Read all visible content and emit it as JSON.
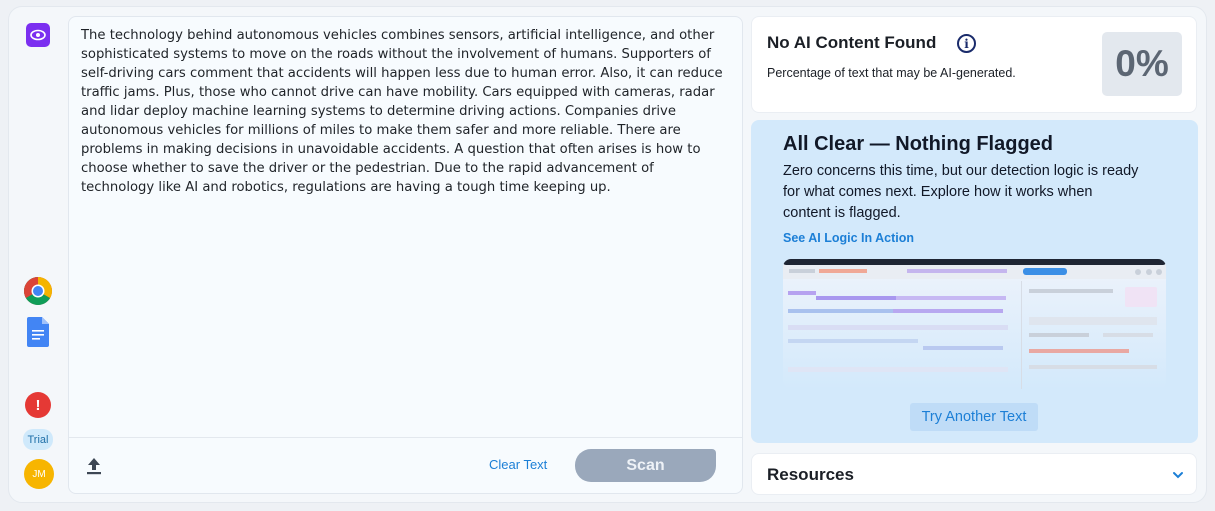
{
  "sidebar": {
    "eye_icon": "eye-icon",
    "chrome_icon": "chrome-icon",
    "docs_icon": "google-docs-icon",
    "alert": "!",
    "trial": "Trial",
    "avatar": "JM"
  },
  "editor": {
    "text": "The technology behind autonomous vehicles combines sensors, artificial intelligence, and other sophisticated systems to move on the roads without the involvement of humans. Supporters of self-driving cars comment that accidents will happen less due to human error. Also, it can reduce traffic jams. Plus, those who cannot drive can have mobility. Cars equipped with cameras, radar and lidar deploy machine learning systems to determine driving actions. Companies drive autonomous vehicles for millions of miles to make them safer and more reliable. There are problems in making decisions in unavoidable accidents. A question that often arises is how to choose whether to save the driver or the pedestrian. Due to the rapid advancement of technology like AI and robotics, regulations are having a tough time keeping up.",
    "clear_label": "Clear Text",
    "scan_label": "Scan"
  },
  "result": {
    "title": "No AI Content Found",
    "subtitle": "Percentage of text that may be AI-generated.",
    "percentage": "0%"
  },
  "all_clear": {
    "title": "All Clear — Nothing Flagged",
    "body": "Zero concerns this time, but our detection logic is ready for what comes next. Explore how it works when content is flagged.",
    "link": "See AI Logic In Action",
    "button": "Try Another Text"
  },
  "resources": {
    "title": "Resources"
  },
  "colors": {
    "accent": "#1c7fd6",
    "brand_purple": "#7b2ff0",
    "card_blue": "#d3e9fb",
    "scan_disabled": "#9aa8bb"
  }
}
